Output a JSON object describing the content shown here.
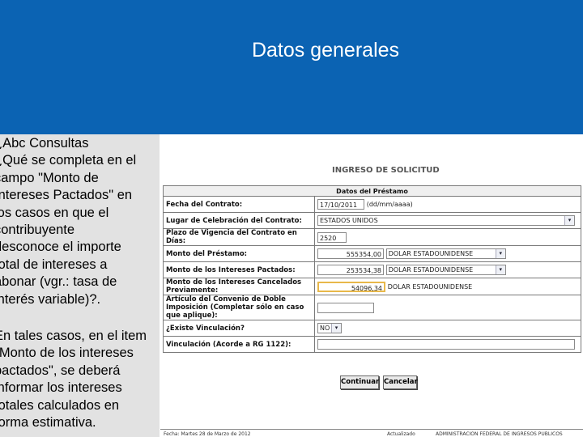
{
  "slide": {
    "title": "Datos generales",
    "question": "¿Abc Consultas\n¿Qué se completa en el\ncampo \"Monto de\nIntereses Pactados\" en\nlos casos en que el\ncontribuyente\ndesconoce el importe\ntotal de intereses a\nabonar (vgr.: tasa de\ninterés variable)?.",
    "answer": "En tales casos, en el item\n\"Monto de los intereses\npactados\", se deberá\ninformar los intereses\ntotales calculados en\nforma estimativa."
  },
  "form": {
    "title": "INGRESO DE SOLICITUD",
    "section": "Datos del Préstamo",
    "fields": {
      "fecha_label": "Fecha del Contrato:",
      "fecha_value": "17/10/2011",
      "fecha_hint": "(dd/mm/aaaa)",
      "lugar_label": "Lugar de Celebración del Contrato:",
      "lugar_value": "ESTADOS UNIDOS",
      "plazo_label": "Plazo de Vigencia del Contrato en Días:",
      "plazo_value": "2520",
      "monto_label": "Monto del Préstamo:",
      "monto_value": "555354,00",
      "monto_currency": "DOLAR ESTADOUNIDENSE",
      "intereses_pactados_label": "Monto de los Intereses Pactados:",
      "intereses_pactados_value": "253534,38",
      "intereses_pactados_currency": "DOLAR ESTADOUNIDENSE",
      "intereses_cancelados_label": "Monto de los Intereses Cancelados Previamente:",
      "intereses_cancelados_value": "54096,34",
      "intereses_cancelados_currency": "DOLAR ESTADOUNIDENSE",
      "articulo_label": "Artículo del Convenio de Doble Imposición (Completar sólo en caso que aplique):",
      "articulo_value": "",
      "vinculacion_existe_label": "¿Existe Vinculación?",
      "vinculacion_existe_value": "NO",
      "vinculacion_label": "Vinculación (Acorde a RG 1122):",
      "vinculacion_value": ""
    },
    "buttons": {
      "continuar": "Continuar",
      "cancelar": "Cancelar"
    },
    "footer": {
      "left": "Fecha: Martes 28 de Marzo de 2012",
      "center": "Actualizado",
      "right": "ADMINISTRACION FEDERAL DE INGRESOS PUBLICOS"
    }
  },
  "colors": {
    "header_bg": "#0b63b3",
    "left_panel_bg": "#e2e2e2",
    "highlight_border": "#e8b84a"
  }
}
